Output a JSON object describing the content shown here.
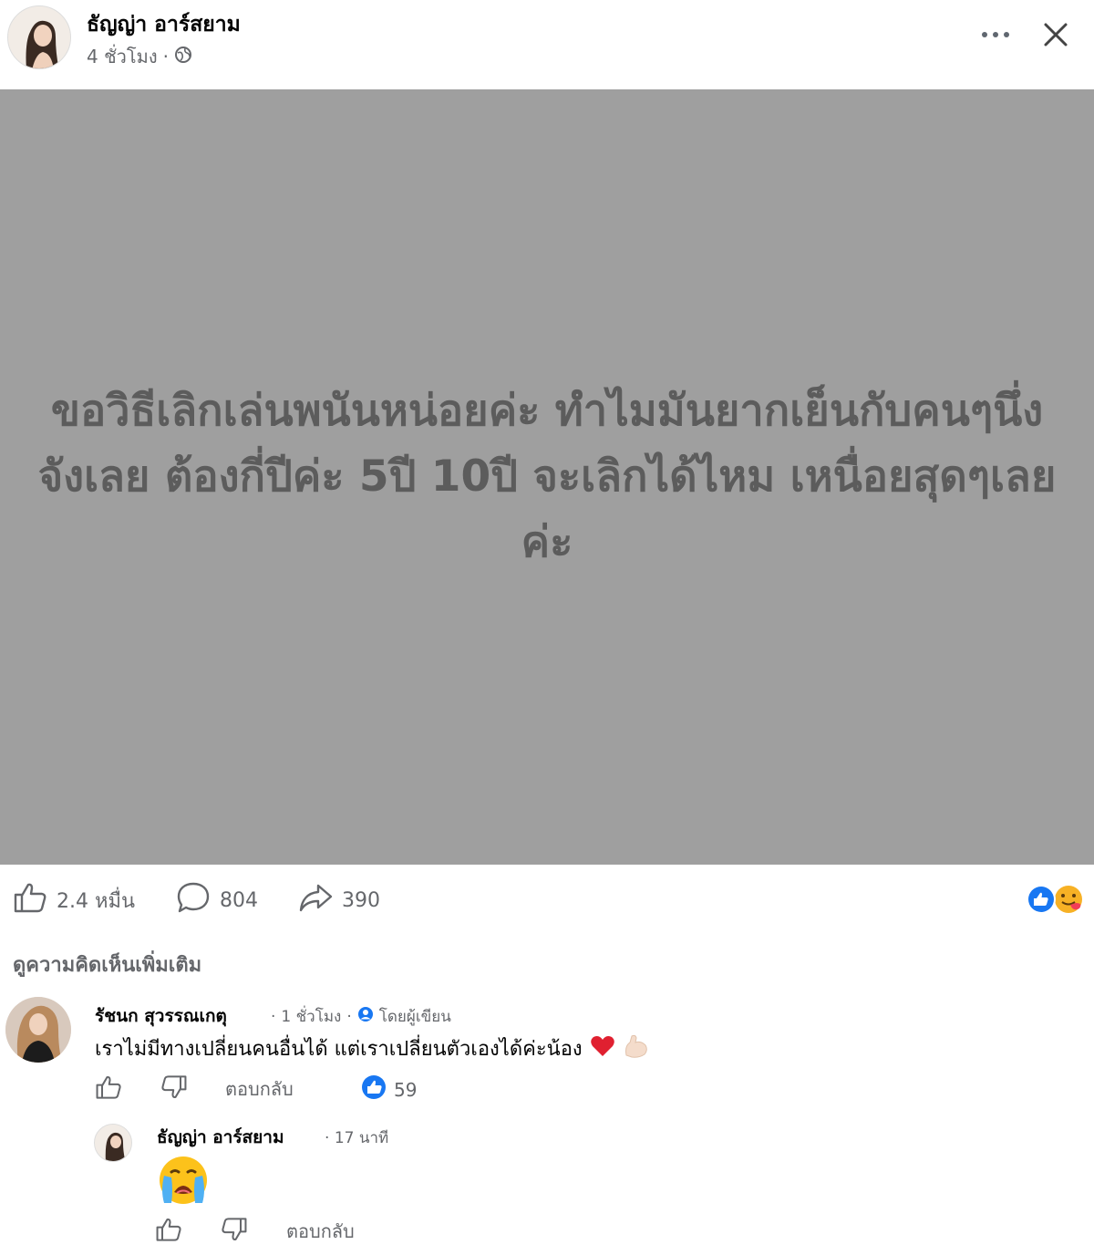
{
  "header": {
    "author_name": "ธัญญ่า อาร์สยาม",
    "time": "4 ชั่วโมง",
    "separator": "·",
    "privacy_icon": "globe-icon",
    "more_icon": "more-icon",
    "close_icon": "close-icon"
  },
  "post": {
    "text": "ขอวิธีเลิกเล่นพนันหน่อยค่ะ ทำไมมันยากเย็นกับคนๆนึ่งจังเลย ต้องกี่ปีค่ะ 5ปี 10ปี จะเลิกได้ไหม เหนื่อยสุดๆเลยค่ะ",
    "background_color": "#9f9f9f",
    "text_color": "#5c5c5c"
  },
  "stats": {
    "likes": "2.4 หมื่น",
    "comments": "804",
    "shares": "390",
    "reactions": [
      "like-reaction-icon",
      "care-reaction-icon"
    ]
  },
  "more_comments_label": "ดูความคิดเห็นเพิ่มเติม",
  "comments": [
    {
      "author": "รัชนก สุวรรณเกตุ",
      "time": "1 ชั่วโมง",
      "badge": "โดยผู้เขียน",
      "text": "เราไม่มีทางเปลี่ยนคนอื่นได้ แต่เราเปลี่ยนตัวเองได้ค่ะน้อง",
      "emojis": [
        "heart-icon",
        "muscle-icon"
      ],
      "reply_label": "ตอบกลับ",
      "like_count": "59"
    }
  ],
  "replies": [
    {
      "author": "ธัญญ่า อาร์สยาม",
      "time": "17 นาที",
      "emoji": "crying-face-icon",
      "reply_label": "ตอบกลับ"
    }
  ],
  "colors": {
    "meta_gray": "#65676b",
    "fb_blue": "#1877f2"
  }
}
